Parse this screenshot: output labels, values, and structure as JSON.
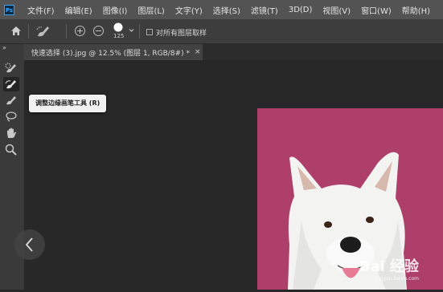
{
  "app": {
    "logo_text": "Ps",
    "menus": [
      "文件(F)",
      "编辑(E)",
      "图像(I)",
      "图层(L)",
      "文字(Y)",
      "选择(S)",
      "滤镜(T)",
      "3D(D)",
      "视图(V)",
      "窗口(W)",
      "帮助(H)"
    ]
  },
  "options_bar": {
    "brush_size": "125",
    "sample_all_layers_label": "对所有图层取样",
    "sample_all_layers_checked": false
  },
  "document_tab": {
    "title": "快速选择 (3).jpg @ 12.5% (图层 1, RGB/8#) *",
    "close_glyph": "×"
  },
  "toolbar": {
    "collapse_glyph": "»",
    "tools": [
      "quick-selection-tool",
      "refine-edge-brush-tool",
      "brush-tool",
      "lasso-tool",
      "hand-tool",
      "zoom-tool"
    ],
    "active_tool": "refine-edge-brush-tool"
  },
  "tooltip": {
    "text": "调整边缘画笔工具 (R)"
  },
  "canvas": {
    "background_color": "#ad3f6a",
    "subject": "white dog",
    "watermark": "Bai 经验",
    "watermark_url": "jingyan.baidu.com"
  }
}
